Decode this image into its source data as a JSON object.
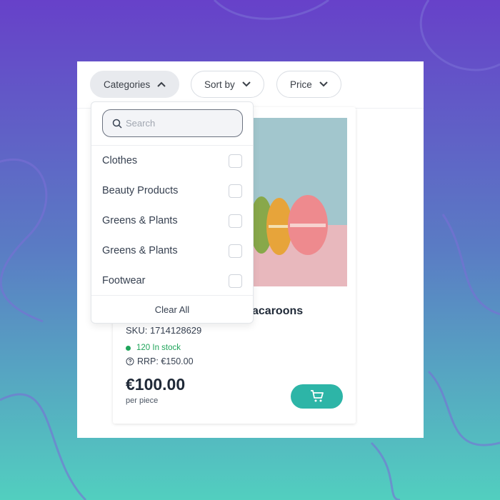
{
  "filters": {
    "categories": "Categories",
    "sort_by": "Sort by",
    "price": "Price"
  },
  "dropdown": {
    "search_placeholder": "Search",
    "items": [
      {
        "label": "Clothes",
        "checked": false
      },
      {
        "label": "Beauty Products",
        "checked": false
      },
      {
        "label": "Greens & Plants",
        "checked": false
      },
      {
        "label": "Greens & Plants",
        "checked": false
      },
      {
        "label": "Footwear",
        "checked": false
      }
    ],
    "clear_all": "Clear All"
  },
  "product": {
    "title_visible": "acaroons",
    "sku": "SKU: 1714128629",
    "stock": "120 In stock",
    "rrp": "RRP: €150.00",
    "price": "€100.00",
    "unit": "per piece"
  },
  "colors": {
    "accent": "#2db5a7",
    "stock": "#1fa45a"
  }
}
